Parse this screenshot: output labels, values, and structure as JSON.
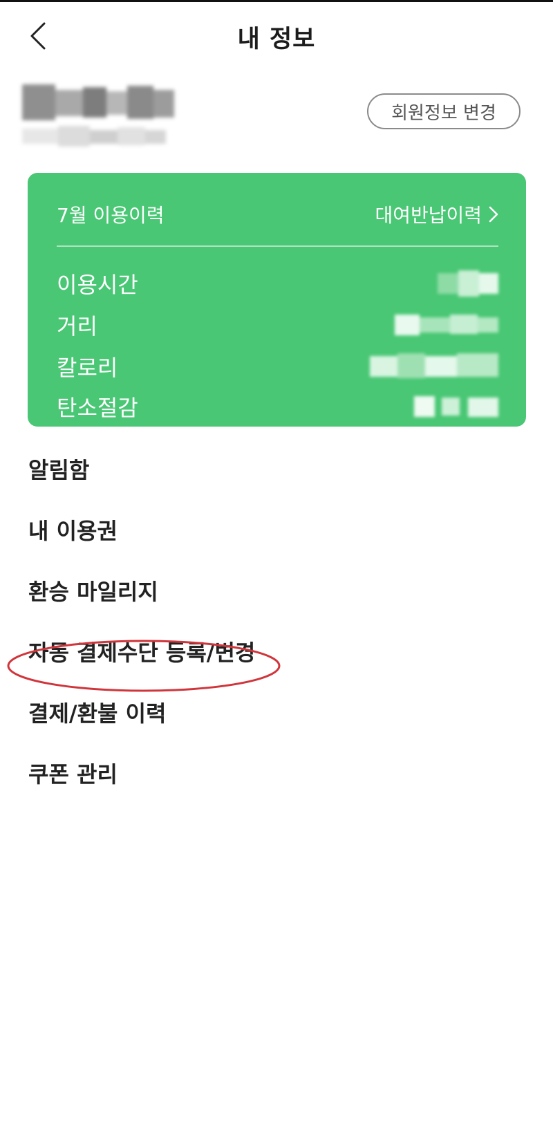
{
  "header": {
    "title": "내 정보",
    "back_icon": "chevron-left-icon"
  },
  "profile": {
    "name": "",
    "id": "",
    "edit_button_label": "회원정보 변경"
  },
  "usage_card": {
    "title": "7월 이용이력",
    "history_link_label": "대여반납이력",
    "history_link_icon": "chevron-right-icon",
    "background_color": "#49c774",
    "stats": [
      {
        "label": "이용시간",
        "value": ""
      },
      {
        "label": "거리",
        "value": ""
      },
      {
        "label": "칼로리",
        "value": ""
      },
      {
        "label": "탄소절감",
        "value": ""
      }
    ]
  },
  "menu": {
    "items": [
      {
        "label": "알림함"
      },
      {
        "label": "내 이용권"
      },
      {
        "label": "환승 마일리지"
      },
      {
        "label": "자동 결제수단 등록/변경",
        "highlighted": true
      },
      {
        "label": "결제/환불 이력"
      },
      {
        "label": "쿠폰 관리"
      }
    ],
    "highlight_color": "#d0353b"
  }
}
